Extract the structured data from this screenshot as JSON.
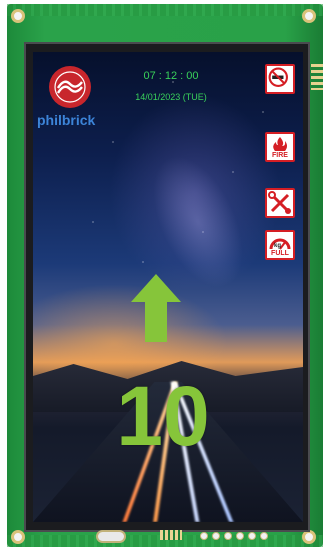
{
  "brand": {
    "name": "philbrick"
  },
  "clock": {
    "time": "07 : 12 : 00",
    "date": "14/01/2023 (TUE)"
  },
  "status_icons": [
    {
      "name": "no-smoking-icon",
      "label": ""
    },
    {
      "name": "fire-alarm-icon",
      "label": "FIRE"
    },
    {
      "name": "maintenance-icon",
      "label": ""
    },
    {
      "name": "overload-icon",
      "label": "FULL",
      "unit": "kg"
    }
  ],
  "elevator": {
    "direction": "up",
    "floor": "10"
  },
  "colors": {
    "accent_green": "#39d15a",
    "floor_green": "#86c53a",
    "sign_red": "#d51e24",
    "brand_blue": "#3c84d8"
  }
}
